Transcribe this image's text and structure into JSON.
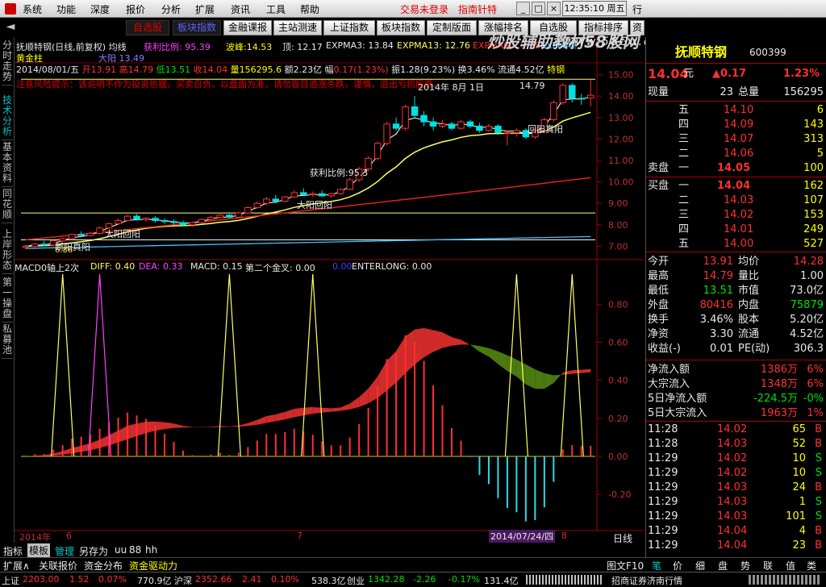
{
  "menu": {
    "items": [
      "系统",
      "功能",
      "深度",
      "报价",
      "分析",
      "扩展",
      "资讯",
      "工具",
      "帮助"
    ],
    "alerts": [
      "交易未登录",
      "指南针特"
    ],
    "time": "12:35:10",
    "weekday": "周五",
    "window_label": "行"
  },
  "toolbar": {
    "pink_items": [
      "自选股",
      "板块指数"
    ],
    "buttons": [
      "金融课报",
      "主站测速",
      "上证指数",
      "板块指数",
      "定制版面",
      "涨幅排名",
      "自选股",
      "指标排序",
      "资"
    ]
  },
  "left_tabs": [
    "分时走势",
    "技术分析",
    "基本资料",
    "同花顺",
    "上岸形态",
    "第一操盘",
    "私募池"
  ],
  "chart": {
    "header": {
      "name": "抚顺特钢(日线,前复权)",
      "ma_label": "均线",
      "profit_ratio_label": "获利比例:",
      "profit_ratio": "95.39",
      "wave_label": "波峰:",
      "wave": "14.53",
      "top_label": "顶:",
      "top": "12.17",
      "expma3": "EXPMA3: 13.84",
      "expma13": "EXPMA13: 12.76",
      "expma60": "EXPMA60: 9.35",
      "expma2": "EXPMA2",
      "gold_label": "黄金柱",
      "purple_label": "大阳",
      "purple_value": "13.49"
    },
    "ohlc_line": {
      "date": "2014/08/01/五",
      "open_label": "开",
      "open": "13.91",
      "high_label": "高",
      "high": "14.79",
      "low_label": "低",
      "low": "13.51",
      "close_label": "收",
      "close": "14.04",
      "vol_label": "量",
      "vol": "156295.6",
      "amount_label": "额",
      "amount": "2.23亿",
      "change_label": "幅",
      "change": "0.17(1.23%)",
      "amplitude_label": "振",
      "amplitude": "1.28(9.23%)",
      "turnover_label": "换",
      "turnover": "3.46%",
      "float_label": "流通",
      "float": "4.52亿",
      "tag": "特钢"
    },
    "notice": "注意风险提示：该说明不作为投资依据，买卖自负。以盘面为准，请勿盲目追涨杀跌，谨慎，退出亏损股票。",
    "date_annotation": "2014年 8月 1日",
    "high_annotation": "14.79",
    "annotations": [
      "获利比例:95.3",
      "大阳回阳",
      "大阳回阳",
      "回阳真阳",
      "断阳真阳"
    ],
    "price_ticks": [
      "15.00",
      "14.00",
      "13.00",
      "12.00",
      "11.00",
      "10.00",
      "9.00",
      "8.00",
      "7.00"
    ],
    "marker_low": "6.86",
    "macd_header": {
      "title": "MACD0轴上2次",
      "diff": "DIFF: 0.40",
      "dea": "DEA: 0.33",
      "macd": "MACD: 0.15",
      "second_cross": "第二个金叉: 0.00",
      "zero": "0.00",
      "enterlong": "ENTERLONG: 0.00"
    },
    "macd_ticks": [
      "0.80",
      "0.60",
      "0.40",
      "0.20",
      "0.00",
      "-0.20",
      "-0.40"
    ],
    "xaxis": {
      "start": "2014年",
      "m6": "6",
      "m7": "7",
      "end_date": "2014/07/24/四",
      "m8": "8"
    }
  },
  "indicator_tabs": [
    "指标",
    "模板",
    "管理",
    "另存为",
    "uu",
    "88",
    "hh"
  ],
  "bottom_tabs": [
    "扩展∧",
    "关联报价",
    "资金分布",
    "资金驱动力"
  ],
  "bottom_right": {
    "label1": "日线",
    "label2": "图文F10",
    "tabs": [
      "笔",
      "价",
      "细",
      "盘",
      "势",
      "联",
      "值",
      "类"
    ]
  },
  "quote": {
    "name": "抚顺特钢",
    "code": "600399",
    "price": "14.04",
    "unit": "元",
    "change": "▲0.17",
    "pct": "1.23%",
    "now_vol_label": "现量",
    "now_vol": "23",
    "total_vol_label": "总量",
    "total_vol": "156295",
    "asks": [
      {
        "label": "五",
        "price": "14.10",
        "vol": "6"
      },
      {
        "label": "四",
        "price": "14.09",
        "vol": "143"
      },
      {
        "label": "三",
        "price": "14.07",
        "vol": "313"
      },
      {
        "label": "二",
        "price": "14.06",
        "vol": "5"
      },
      {
        "label": "一",
        "price": "14.05",
        "vol": "100"
      }
    ],
    "sell_label": "卖盘",
    "buy_label": "买盘",
    "bids": [
      {
        "label": "一",
        "price": "14.04",
        "vol": "162"
      },
      {
        "label": "二",
        "price": "14.03",
        "vol": "107"
      },
      {
        "label": "三",
        "price": "14.02",
        "vol": "153"
      },
      {
        "label": "四",
        "price": "14.01",
        "vol": "249"
      },
      {
        "label": "五",
        "price": "14.00",
        "vol": "527"
      }
    ],
    "stats": [
      {
        "l1": "今开",
        "v1": "13.91",
        "l2": "均价",
        "v2": "14.28"
      },
      {
        "l1": "最高",
        "v1": "14.79",
        "l2": "量比",
        "v2": "1.00"
      },
      {
        "l1": "最低",
        "v1": "13.51",
        "l2": "市值",
        "v2": "73.0亿"
      },
      {
        "l1": "外盘",
        "v1": "80416",
        "l2": "内盘",
        "v2": "75879"
      },
      {
        "l1": "换手",
        "v1": "3.46%",
        "l2": "股本",
        "v2": "5.20亿"
      },
      {
        "l1": "净资",
        "v1": "3.30",
        "l2": "流通",
        "v2": "4.52亿"
      },
      {
        "l1": "收益(-)",
        "v1": "0.01",
        "l2": "PE(动)",
        "v2": "306.3"
      }
    ],
    "flows": [
      {
        "label": "净流入额",
        "value": "1386万",
        "pct": "6%"
      },
      {
        "label": "大宗流入",
        "value": "1348万",
        "pct": "6%"
      },
      {
        "label": "5日净流入额",
        "value": "-224.5万",
        "pct": "-0%"
      },
      {
        "label": "5日大宗流入",
        "value": "1963万",
        "pct": "1%"
      }
    ],
    "ticks": [
      {
        "time": "11:28",
        "price": "14.02",
        "vol": "65",
        "side": "B"
      },
      {
        "time": "11:28",
        "price": "14.03",
        "vol": "52",
        "side": "B"
      },
      {
        "time": "11:29",
        "price": "14.02",
        "vol": "10",
        "side": "S"
      },
      {
        "time": "11:29",
        "price": "14.02",
        "vol": "10",
        "side": "S"
      },
      {
        "time": "11:29",
        "price": "14.03",
        "vol": "24",
        "side": "B"
      },
      {
        "time": "11:29",
        "price": "14.03",
        "vol": "1",
        "side": "S"
      },
      {
        "time": "11:29",
        "price": "14.03",
        "vol": "101",
        "side": "S"
      },
      {
        "time": "11:29",
        "price": "14.04",
        "vol": "4",
        "side": "B"
      },
      {
        "time": "11:29",
        "price": "14.04",
        "vol": "23",
        "side": "B"
      }
    ]
  },
  "status": {
    "sh_label": "上证",
    "sh": "2203.00",
    "sh_chg": "1.52",
    "sh_pct": "0.07%",
    "sh_amt": "770.9亿",
    "sz_label": "沪深",
    "sz": "2352.66",
    "sz_chg": "2.41",
    "sz_pct": "0.10%",
    "sz_amt": "538.3亿",
    "cy_label": "创业",
    "cy": "1342.28",
    "cy_chg": "-2.26",
    "cy_pct": "-0.17%",
    "cy_amt": "131.4亿",
    "broker": "招商证券济南行情"
  },
  "watermark": {
    "line1": "炒股辅助教材58股网",
    "line2": "www.58Gu.com"
  },
  "chart_data": {
    "type": "candlestick",
    "title": "抚顺特钢(日线,前复权)",
    "ylim": [
      6.6,
      15.4
    ],
    "candles": [
      {
        "o": 6.95,
        "h": 7.05,
        "l": 6.86,
        "c": 7.0
      },
      {
        "o": 7.0,
        "h": 7.15,
        "l": 6.95,
        "c": 7.1
      },
      {
        "o": 7.1,
        "h": 7.25,
        "l": 7.0,
        "c": 7.05
      },
      {
        "o": 7.05,
        "h": 7.3,
        "l": 7.0,
        "c": 7.25
      },
      {
        "o": 7.25,
        "h": 7.4,
        "l": 7.2,
        "c": 7.35
      },
      {
        "o": 7.35,
        "h": 7.6,
        "l": 7.3,
        "c": 7.55
      },
      {
        "o": 7.55,
        "h": 7.7,
        "l": 7.45,
        "c": 7.5
      },
      {
        "o": 7.5,
        "h": 7.65,
        "l": 7.45,
        "c": 7.6
      },
      {
        "o": 7.6,
        "h": 7.9,
        "l": 7.55,
        "c": 7.85
      },
      {
        "o": 7.85,
        "h": 8.1,
        "l": 7.8,
        "c": 8.05
      },
      {
        "o": 8.05,
        "h": 8.3,
        "l": 8.0,
        "c": 8.2
      },
      {
        "o": 8.2,
        "h": 8.45,
        "l": 8.15,
        "c": 8.4
      },
      {
        "o": 8.4,
        "h": 8.5,
        "l": 8.2,
        "c": 8.25
      },
      {
        "o": 8.25,
        "h": 8.35,
        "l": 8.15,
        "c": 8.3
      },
      {
        "o": 8.3,
        "h": 8.4,
        "l": 8.1,
        "c": 8.2
      },
      {
        "o": 8.2,
        "h": 8.3,
        "l": 8.05,
        "c": 8.15
      },
      {
        "o": 8.15,
        "h": 8.25,
        "l": 8.0,
        "c": 8.1
      },
      {
        "o": 8.1,
        "h": 8.2,
        "l": 7.95,
        "c": 8.0
      },
      {
        "o": 8.0,
        "h": 8.15,
        "l": 7.9,
        "c": 8.1
      },
      {
        "o": 8.1,
        "h": 8.3,
        "l": 8.05,
        "c": 8.25
      },
      {
        "o": 8.25,
        "h": 8.4,
        "l": 8.2,
        "c": 8.35
      },
      {
        "o": 8.35,
        "h": 8.5,
        "l": 8.3,
        "c": 8.45
      },
      {
        "o": 8.45,
        "h": 8.5,
        "l": 8.3,
        "c": 8.35
      },
      {
        "o": 8.35,
        "h": 8.6,
        "l": 8.3,
        "c": 8.55
      },
      {
        "o": 8.55,
        "h": 8.85,
        "l": 8.5,
        "c": 8.8
      },
      {
        "o": 8.8,
        "h": 9.1,
        "l": 8.75,
        "c": 9.0
      },
      {
        "o": 9.0,
        "h": 9.3,
        "l": 8.9,
        "c": 9.2
      },
      {
        "o": 9.2,
        "h": 9.4,
        "l": 9.0,
        "c": 9.1
      },
      {
        "o": 9.1,
        "h": 9.35,
        "l": 9.05,
        "c": 9.3
      },
      {
        "o": 9.3,
        "h": 9.6,
        "l": 9.25,
        "c": 9.5
      },
      {
        "o": 9.5,
        "h": 9.7,
        "l": 9.35,
        "c": 9.4
      },
      {
        "o": 9.4,
        "h": 9.55,
        "l": 9.3,
        "c": 9.45
      },
      {
        "o": 9.45,
        "h": 9.6,
        "l": 9.3,
        "c": 9.35
      },
      {
        "o": 9.35,
        "h": 9.5,
        "l": 9.25,
        "c": 9.45
      },
      {
        "o": 9.45,
        "h": 9.7,
        "l": 9.4,
        "c": 9.65
      },
      {
        "o": 9.65,
        "h": 10.2,
        "l": 9.6,
        "c": 10.1
      },
      {
        "o": 10.1,
        "h": 10.7,
        "l": 10.0,
        "c": 10.6
      },
      {
        "o": 10.6,
        "h": 11.2,
        "l": 10.5,
        "c": 11.1
      },
      {
        "o": 11.1,
        "h": 11.9,
        "l": 11.0,
        "c": 11.8
      },
      {
        "o": 11.8,
        "h": 12.8,
        "l": 11.7,
        "c": 12.7
      },
      {
        "o": 12.7,
        "h": 13.0,
        "l": 12.4,
        "c": 12.5
      },
      {
        "o": 12.5,
        "h": 13.6,
        "l": 12.4,
        "c": 13.5
      },
      {
        "o": 13.5,
        "h": 14.0,
        "l": 13.0,
        "c": 13.1
      },
      {
        "o": 13.1,
        "h": 13.3,
        "l": 12.6,
        "c": 12.8
      },
      {
        "o": 12.8,
        "h": 13.0,
        "l": 12.4,
        "c": 12.6
      },
      {
        "o": 12.6,
        "h": 12.9,
        "l": 12.5,
        "c": 12.7
      },
      {
        "o": 12.7,
        "h": 12.8,
        "l": 12.4,
        "c": 12.5
      },
      {
        "o": 12.5,
        "h": 12.9,
        "l": 12.45,
        "c": 12.8
      },
      {
        "o": 12.8,
        "h": 12.9,
        "l": 12.5,
        "c": 12.6
      },
      {
        "o": 12.6,
        "h": 12.75,
        "l": 12.3,
        "c": 12.4
      },
      {
        "o": 12.4,
        "h": 12.7,
        "l": 12.35,
        "c": 12.6
      },
      {
        "o": 12.6,
        "h": 12.7,
        "l": 12.2,
        "c": 12.3
      },
      {
        "o": 12.3,
        "h": 12.4,
        "l": 11.7,
        "c": 12.3
      },
      {
        "o": 12.3,
        "h": 12.5,
        "l": 12.1,
        "c": 12.4
      },
      {
        "o": 12.4,
        "h": 12.5,
        "l": 12.0,
        "c": 12.1
      },
      {
        "o": 12.1,
        "h": 12.5,
        "l": 12.0,
        "c": 12.4
      },
      {
        "o": 12.4,
        "h": 13.0,
        "l": 12.35,
        "c": 12.9
      },
      {
        "o": 12.9,
        "h": 13.8,
        "l": 12.8,
        "c": 13.7
      },
      {
        "o": 13.7,
        "h": 14.6,
        "l": 13.6,
        "c": 14.5
      },
      {
        "o": 14.5,
        "h": 14.6,
        "l": 13.7,
        "c": 13.9
      },
      {
        "o": 13.9,
        "h": 14.1,
        "l": 13.6,
        "c": 13.87
      },
      {
        "o": 13.91,
        "h": 14.79,
        "l": 13.51,
        "c": 14.04
      }
    ],
    "expma3_color": "#ffffff",
    "expma13_color": "#ffff60",
    "expma60_color": "#e02020",
    "long_ma_color": "#40c0ff"
  }
}
